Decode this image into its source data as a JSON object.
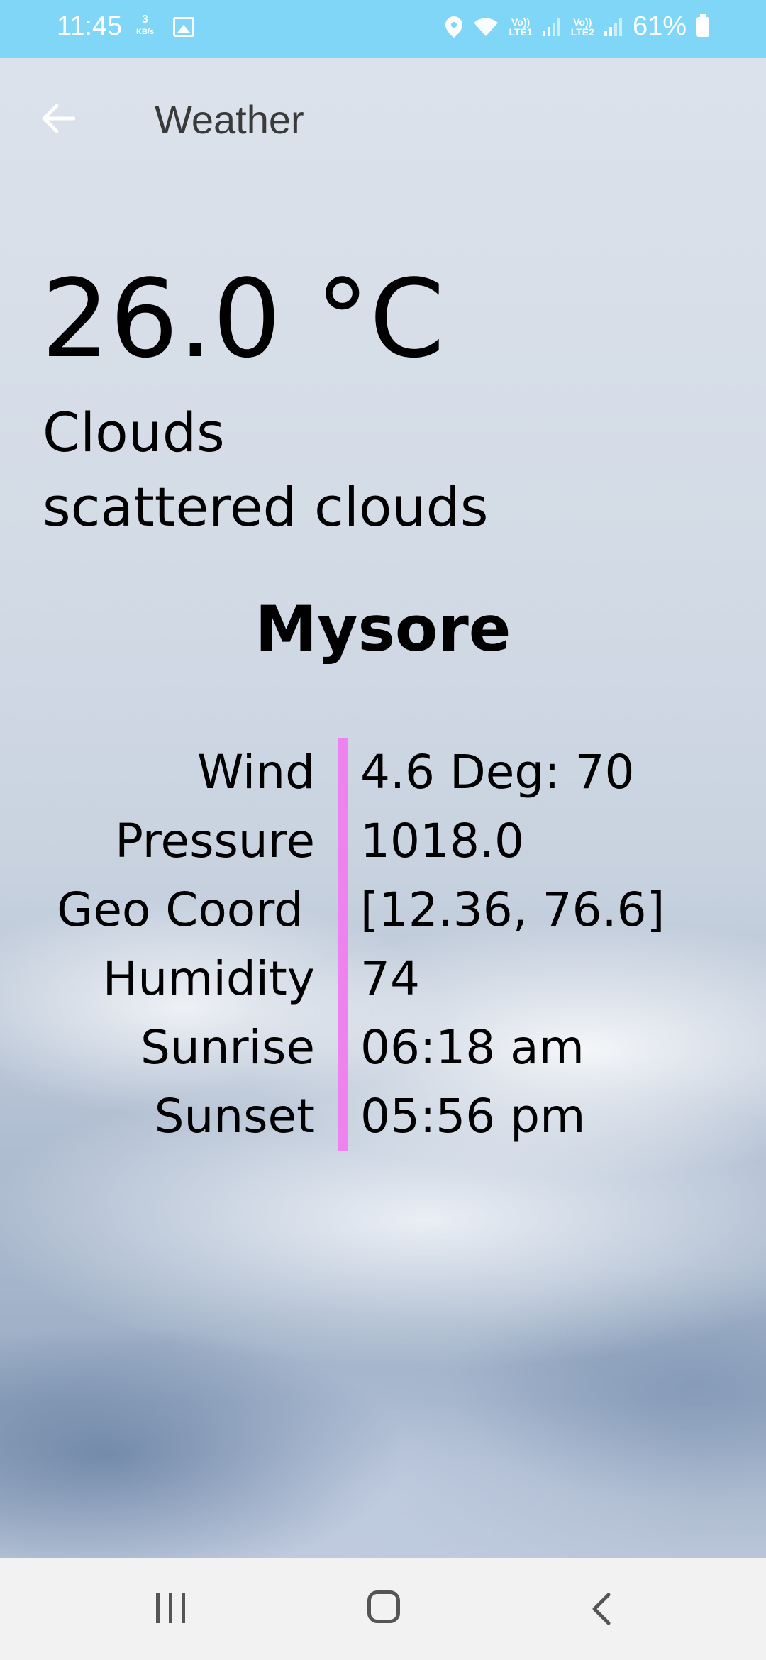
{
  "status_bar": {
    "time": "11:45",
    "speed_value": "3",
    "speed_unit": "KB/s",
    "sim1": "Vo))\nLTE1",
    "sim2": "Vo))\nLTE2",
    "battery": "61%"
  },
  "app_bar": {
    "title": "Weather",
    "back_icon": "arrow-left-icon"
  },
  "weather": {
    "temperature": "26.0 °C",
    "main": "Clouds",
    "description": "scattered clouds",
    "city": "Mysore"
  },
  "details": [
    {
      "label": "Wind",
      "value": "4.6 Deg: 70"
    },
    {
      "label": "Pressure",
      "value": "1018.0"
    },
    {
      "label": "Geo Coord",
      "value": "[12.36, 76.6]"
    },
    {
      "label": "Humidity",
      "value": "74"
    },
    {
      "label": "Sunrise",
      "value": "06:18 am"
    },
    {
      "label": "Sunset",
      "value": "05:56 pm"
    }
  ],
  "colors": {
    "status_bar_bg": "#7fd6f7",
    "divider": "#ee82ee",
    "nav_bar_bg": "#f2f2f2"
  },
  "nav_bar": {
    "recent_icon": "recent-apps-icon",
    "home_icon": "home-icon",
    "back_icon": "back-chevron-icon"
  }
}
